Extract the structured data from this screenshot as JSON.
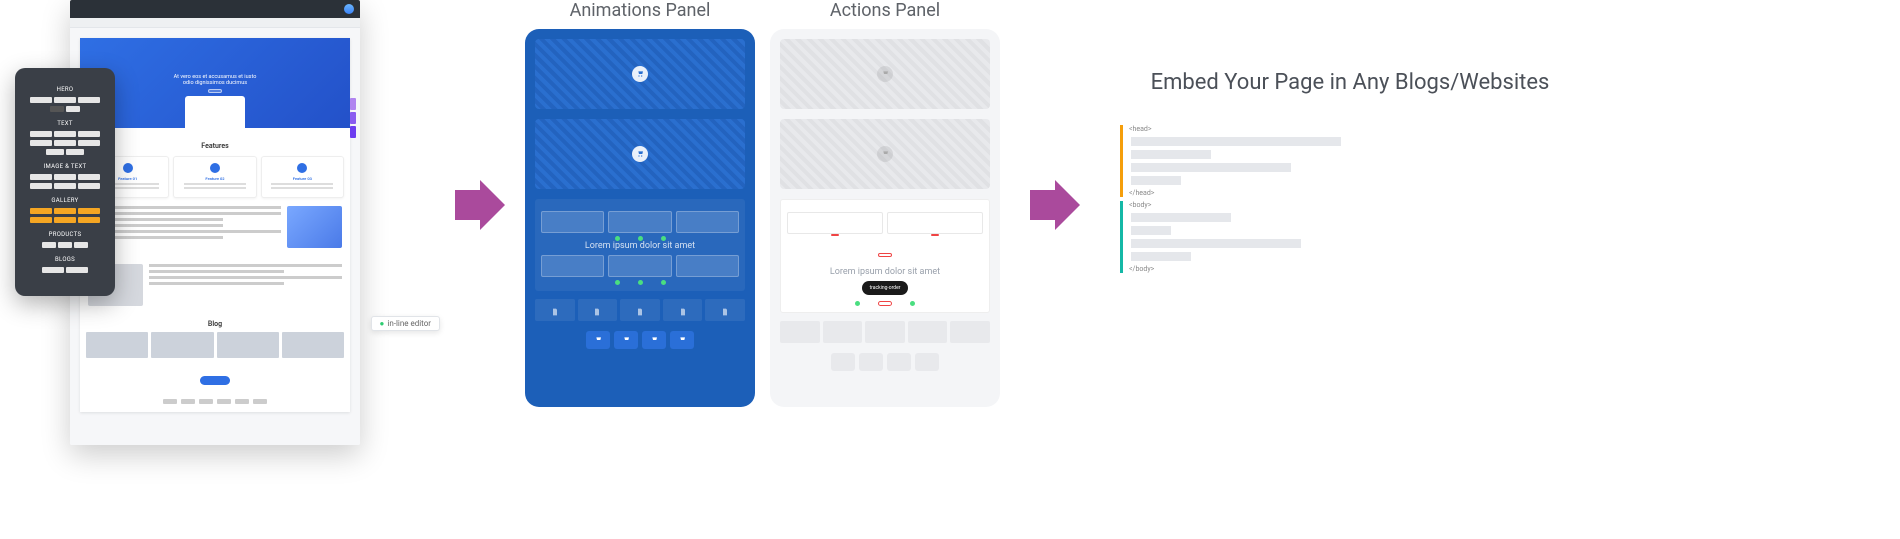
{
  "stage1": {
    "palette": {
      "sections": {
        "hero": "HERO",
        "text": "TEXT",
        "image_text": "IMAGE & TEXT",
        "gallery": "GALLERY",
        "products": "PRODUCTS",
        "blogs": "BLOGS"
      }
    },
    "page": {
      "hero": {
        "headline": "At vero eos et accusamus et iusto",
        "subhead": "odio dignissimos ducimus"
      },
      "features": {
        "title": "Features",
        "cards": [
          {
            "title": "Feature 01"
          },
          {
            "title": "Feature 02"
          },
          {
            "title": "Feature 03"
          }
        ]
      },
      "blog_title": "Blog"
    },
    "inline_tag": "in-line editor"
  },
  "panels": {
    "animations_title": "Animations Panel",
    "actions_title": "Actions Panel",
    "lorem": "Lorem ipsum dolor sit amet",
    "tracking_tooltip": "tracking-order"
  },
  "embed": {
    "title": "Embed Your Page in Any Blogs/Websites",
    "head_open": "<head>",
    "head_close": "</head>",
    "body_open": "<body>",
    "body_close": "</body>"
  },
  "colors": {
    "arrow": "#aa4a9c"
  }
}
